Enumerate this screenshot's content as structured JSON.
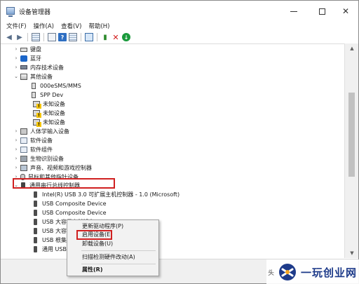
{
  "window": {
    "title": "设备管理器"
  },
  "menubar": [
    "文件(F)",
    "操作(A)",
    "查看(V)",
    "帮助(H)"
  ],
  "toolbar": {
    "icons": [
      "back-arrow-icon",
      "forward-arrow-icon",
      "show-grid-icon",
      "properties-icon",
      "help-icon",
      "device-view-icon",
      "monitor-icon",
      "update-driver-icon",
      "uninstall-x-icon",
      "enable-device-icon"
    ]
  },
  "tree": {
    "rows": [
      {
        "label": "键盘",
        "expander": ">",
        "icon": "keyboard-icon"
      },
      {
        "label": "蓝牙",
        "expander": ">",
        "icon": "bluetooth-icon"
      },
      {
        "label": "内存技术设备",
        "expander": ">",
        "icon": "memory-icon"
      },
      {
        "label": "其他设备",
        "expander": "v",
        "icon": "other-devices-icon"
      },
      {
        "label": "000eSMS/MMS",
        "expander": "",
        "icon": "phone-device-icon"
      },
      {
        "label": "SPP Dev",
        "expander": "",
        "icon": "phone-device-icon"
      },
      {
        "label": "未知设备",
        "expander": "",
        "icon": "unknown-device-icon"
      },
      {
        "label": "未知设备",
        "expander": "",
        "icon": "unknown-device-icon"
      },
      {
        "label": "未知设备",
        "expander": "",
        "icon": "unknown-device-icon"
      },
      {
        "label": "人体学输入设备",
        "expander": ">",
        "icon": "hid-icon"
      },
      {
        "label": "软件设备",
        "expander": ">",
        "icon": "software-device-icon"
      },
      {
        "label": "软件组件",
        "expander": ">",
        "icon": "software-component-icon"
      },
      {
        "label": "生物识别设备",
        "expander": ">",
        "icon": "biometric-icon"
      },
      {
        "label": "声音、视频和游戏控制器",
        "expander": ">",
        "icon": "sound-icon"
      },
      {
        "label": "鼠标和其他指针设备",
        "expander": ">",
        "icon": "mouse-icon"
      },
      {
        "label": "通用串行总线控制器",
        "expander": "v",
        "icon": "usb-controller-icon"
      },
      {
        "label": "Intel(R) USB 3.0 可扩展主机控制器 - 1.0 (Microsoft)",
        "expander": "",
        "icon": "usb-plug-icon"
      },
      {
        "label": "USB Composite Device",
        "expander": "",
        "icon": "usb-plug-icon"
      },
      {
        "label": "USB Composite Device",
        "expander": "",
        "icon": "usb-plug-icon"
      },
      {
        "label": "USB 大容量存储设备",
        "expander": "",
        "icon": "usb-plug-icon"
      },
      {
        "label": "USB 大容",
        "expander": "",
        "icon": "usb-plug-icon"
      },
      {
        "label": "USB 根集",
        "expander": "",
        "icon": "usb-plug-icon"
      },
      {
        "label": "通用 USB",
        "expander": "",
        "icon": "usb-plug-icon"
      }
    ]
  },
  "context_menu": {
    "items": [
      "更新驱动程序(P)",
      "启用设备(E)",
      "卸载设备(U)",
      "扫描检测硬件改动(A)",
      "属性(R)"
    ]
  },
  "watermark": {
    "prefix": "头",
    "text": "一玩创业网"
  },
  "colors": {
    "highlight_border": "#d02020",
    "selection": "#cce4f7",
    "watermark_blue": "#1e3b8a"
  }
}
